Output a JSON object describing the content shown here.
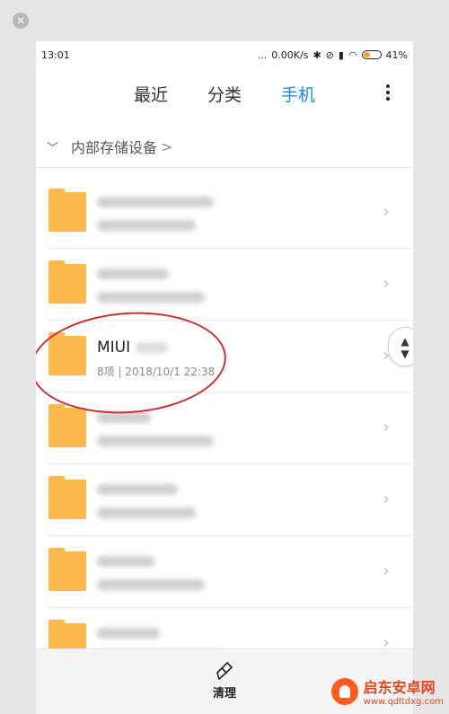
{
  "status_bar": {
    "time": "13:01",
    "dots": "...",
    "network_speed": "0.00K/s",
    "battery_percent": "41%",
    "battery_level": 0.41
  },
  "tabs": [
    {
      "label": "最近",
      "active": false
    },
    {
      "label": "分类",
      "active": false
    },
    {
      "label": "手机",
      "active": true
    }
  ],
  "colors": {
    "accent": "#1e88e5",
    "folder": "#fdb94e",
    "annotation": "#c9302c"
  },
  "breadcrumb": {
    "label": "内部存储设备",
    "arrow": ">"
  },
  "rows": [
    {
      "title": "",
      "meta": "",
      "blurred": true
    },
    {
      "title": "",
      "meta": "",
      "blurred": true
    },
    {
      "title": "MIUI",
      "meta": "8项 | 2018/10/1 22:38",
      "blurred": false
    },
    {
      "title": "",
      "meta": "",
      "blurred": true
    },
    {
      "title": "",
      "meta": "",
      "blurred": true
    },
    {
      "title": "",
      "meta": "",
      "blurred": true
    },
    {
      "title": "",
      "meta": "",
      "blurred": true
    }
  ],
  "bottom_bar": {
    "clean_label": "清理"
  },
  "watermark": {
    "name": "启东安卓网",
    "url": "www.qdltdxg.com"
  }
}
